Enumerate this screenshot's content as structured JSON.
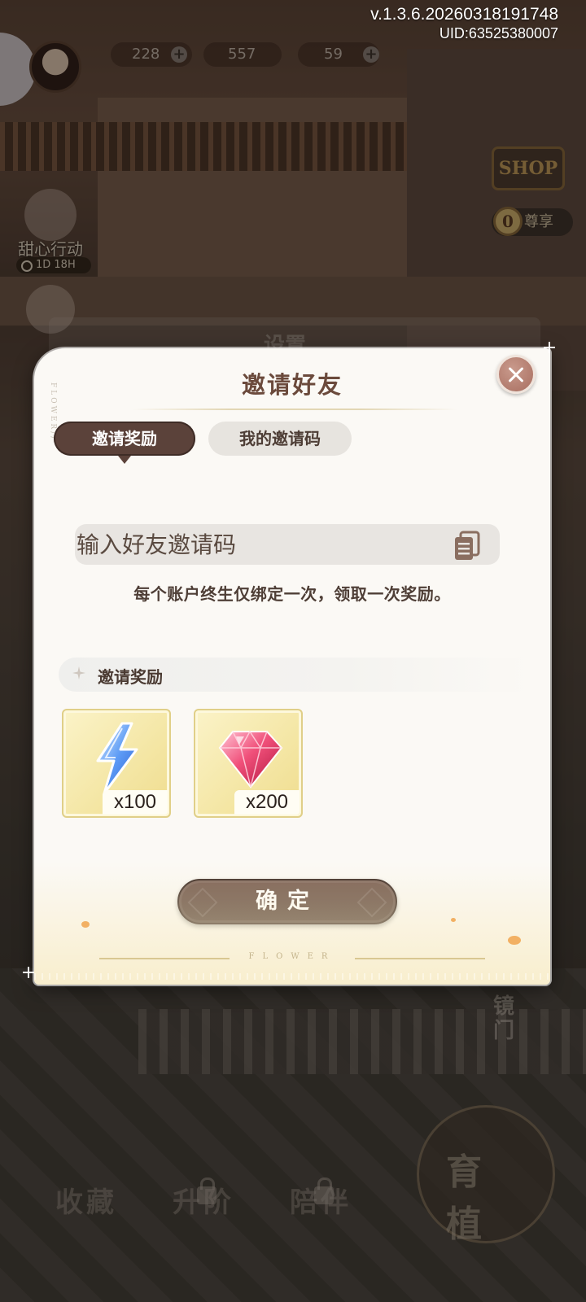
{
  "version": {
    "build": "v.1.3.6.20260318191748",
    "uid": "UID:63525380007"
  },
  "hud": {
    "energy": "228",
    "coins": "557",
    "gems": "59"
  },
  "background": {
    "event_label": "甜心行动",
    "event_timer": "1D 18H",
    "behind_dialog_title": "设置",
    "shop_sign": "SHOP",
    "rank_count": "0",
    "rank_label": "尊享",
    "door_label": "镜门",
    "growth_button": "育植",
    "bottom_tabs": [
      "收藏",
      "升阶",
      "陪伴"
    ]
  },
  "dialog": {
    "title": "邀请好友",
    "side_decoration": "FLOWER//",
    "tabs": [
      {
        "label": "邀请奖励",
        "active": true
      },
      {
        "label": "我的邀请码",
        "active": false
      }
    ],
    "code_input": {
      "placeholder": "输入好友邀请码",
      "value": ""
    },
    "paste_icon": "clipboard-paste-icon",
    "note": "每个账户终生仅绑定一次，领取一次奖励。",
    "rewards_section_label": "邀请奖励",
    "rewards": [
      {
        "icon": "lightning-energy-icon",
        "count": "x100"
      },
      {
        "icon": "ruby-gem-icon",
        "count": "x200"
      }
    ],
    "confirm_label": "确定",
    "footer_decoration": "FLOWER"
  },
  "colors": {
    "dialog_bg": "#fbf9f5",
    "title": "#6b4a3c",
    "tab_active": "#5b423a",
    "tab_inactive": "#e7e4df",
    "close_button": "#a86e60",
    "reward_tile": "#f4e6a4",
    "confirm_button": "#4f3a32"
  }
}
